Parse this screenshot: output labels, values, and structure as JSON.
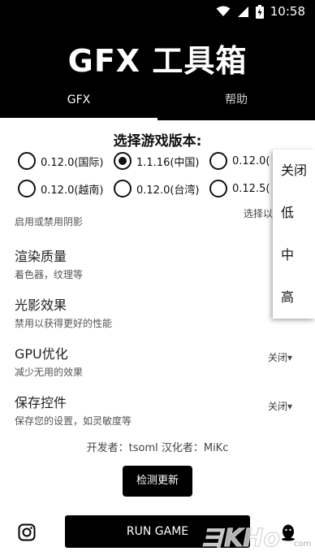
{
  "status": {
    "time": "10:58"
  },
  "header": {
    "title": "GFX 工具箱",
    "tabs": [
      {
        "label": "GFX"
      },
      {
        "label": "帮助"
      }
    ]
  },
  "version": {
    "title": "选择游戏版本:",
    "options": [
      {
        "label": "0.12.0(国际)",
        "checked": false
      },
      {
        "label": "1.1.16(中国)",
        "checked": true
      },
      {
        "label": "0.12.0(",
        "checked": false
      },
      {
        "label": "0.12.0(越南)",
        "checked": false
      },
      {
        "label": "0.12.0(台湾)",
        "checked": false
      },
      {
        "label": "0.12.5(",
        "checked": false
      }
    ]
  },
  "settings": {
    "partial_title": "...",
    "partial_sub": "启用或禁用阴影",
    "partial_value": "选择以",
    "items": [
      {
        "title": "渲染质量",
        "sub": "着色器，纹理等",
        "value": ""
      },
      {
        "title": "光影效果",
        "sub": "禁用以获得更好的性能",
        "value": ""
      },
      {
        "title": "GPU优化",
        "sub": "减少无用的效果",
        "value": "关闭▾"
      },
      {
        "title": "保存控件",
        "sub": "保存您的设置，如灵敏度等",
        "value": "关闭▾"
      }
    ]
  },
  "credits": "开发者：tsoml    汉化者：MiKc",
  "buttons": {
    "update": "检测更新",
    "run": "RUN GAME"
  },
  "dropdown": {
    "options": [
      "关闭",
      "低",
      "中",
      "高"
    ]
  },
  "watermark": {
    "text": "ヨKHo",
    "sub": "com"
  },
  "icons": {
    "instagram": "instagram-icon",
    "qq": "qq-icon"
  }
}
